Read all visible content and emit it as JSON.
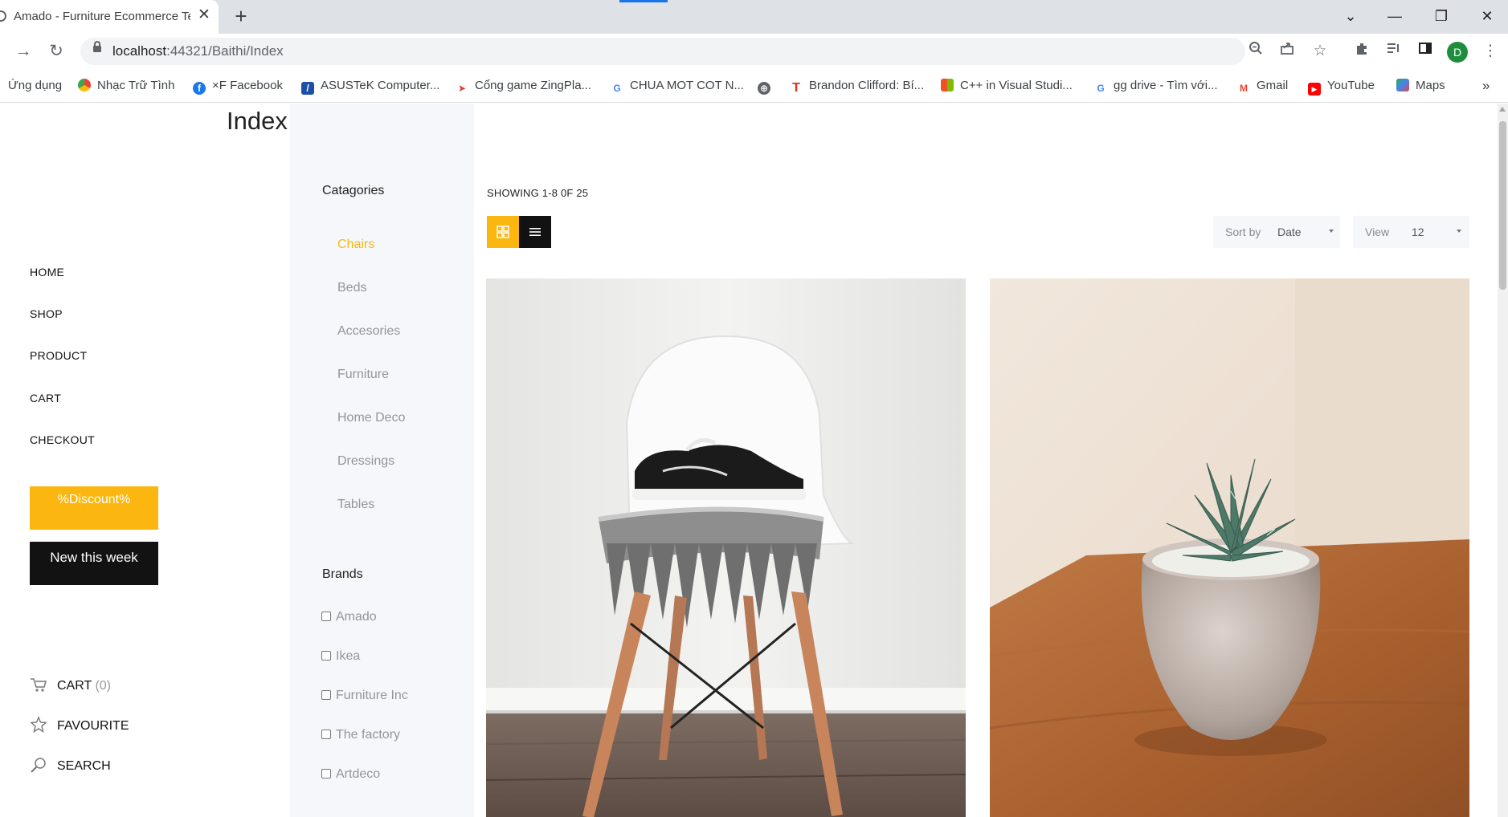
{
  "browser": {
    "tab_title": "Amado - Furniture Ecommerce Template | Shop",
    "url_host": "localhost",
    "url_path": ":44321/Baithi/Index",
    "avatar_letter": "D",
    "bookmarks": [
      {
        "label": "Ứng dụng",
        "icon": "apps-grid-icon"
      },
      {
        "label": "Nhạc Trữ Tình",
        "icon": "chrome-icon"
      },
      {
        "label": "×F Facebook",
        "icon": "facebook-icon"
      },
      {
        "label": "ASUSTeK Computer...",
        "icon": "asus-icon"
      },
      {
        "label": "Cổng game ZingPla...",
        "icon": "zingplay-icon"
      },
      {
        "label": "CHUA MOT COT N...",
        "icon": "google-icon"
      },
      {
        "label": "",
        "icon": "globe-icon"
      },
      {
        "label": "Brandon Clifford: Bí...",
        "icon": "ted-icon"
      },
      {
        "label": "C++ in Visual Studi...",
        "icon": "microsoft-icon"
      },
      {
        "label": "gg drive - Tìm với...",
        "icon": "google-icon"
      },
      {
        "label": "Gmail",
        "icon": "gmail-icon"
      },
      {
        "label": "YouTube",
        "icon": "youtube-icon"
      },
      {
        "label": "Maps",
        "icon": "maps-icon"
      }
    ],
    "more_bookmarks": "»"
  },
  "page": {
    "title": "Index",
    "nav": [
      "HOME",
      "SHOP",
      "PRODUCT",
      "CART",
      "CHECKOUT"
    ],
    "discount_button": "%Discount%",
    "new_button": "New this week",
    "cart_label": "CART",
    "cart_count": "(0)",
    "favourite_label": "FAVOURITE",
    "search_label": "SEARCH"
  },
  "filters": {
    "categories_heading": "Catagories",
    "categories": [
      "Chairs",
      "Beds",
      "Accesories",
      "Furniture",
      "Home Deco",
      "Dressings",
      "Tables"
    ],
    "active_category": "Chairs",
    "brands_heading": "Brands",
    "brands": [
      "Amado",
      "Ikea",
      "Furniture Inc",
      "The factory",
      "Artdeco"
    ]
  },
  "products_toolbar": {
    "showing": "SHOWING 1-8 0F 25",
    "sort_label": "Sort by",
    "sort_value": "Date",
    "view_label": "View",
    "view_value": "12"
  },
  "products": [
    {
      "image": "white chair with sneakers and blanket"
    },
    {
      "image": "succulent in pot on wooden table"
    }
  ],
  "colors": {
    "accent": "#fbb710",
    "dark": "#131212",
    "filter_bg": "#f5f7fa",
    "muted_text": "#959595"
  }
}
